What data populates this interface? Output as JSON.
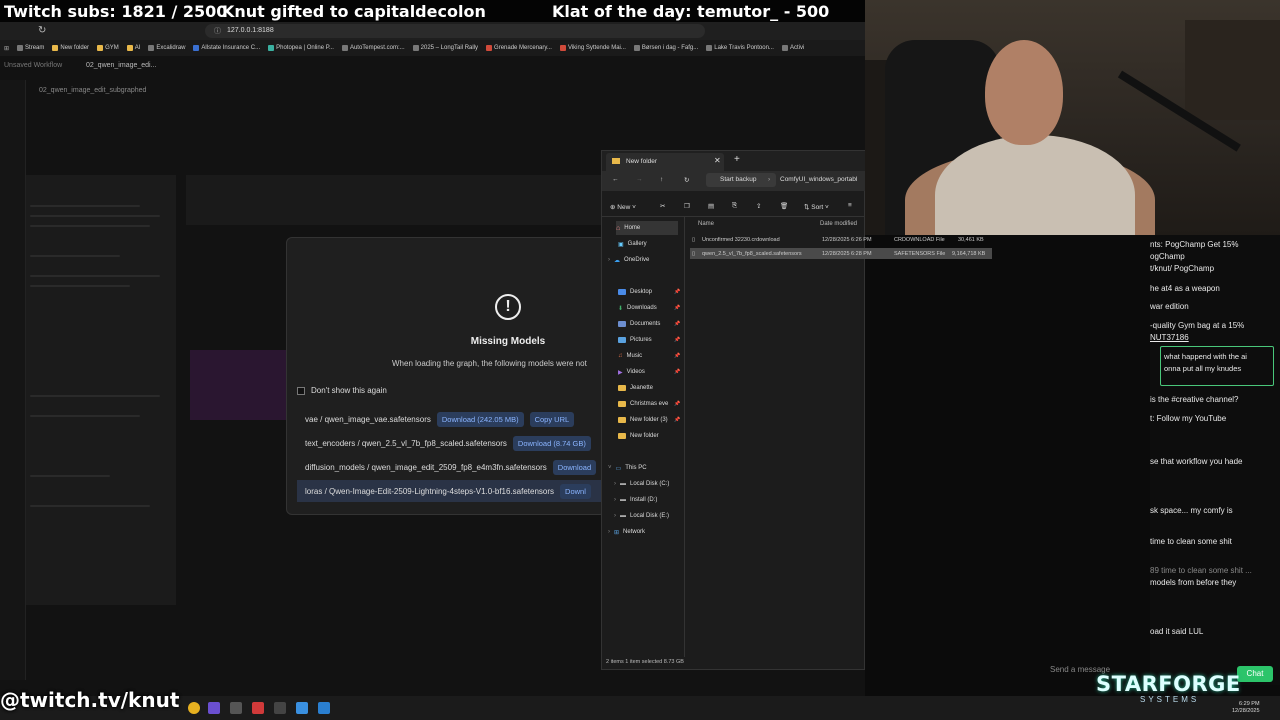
{
  "overlay": {
    "subs_text": "Twitch subs: 1821 / 2500",
    "gift_text": "Knut gifted to capitaldecolon",
    "klat_text": "Klat of the day: temutor_ - 500"
  },
  "browser": {
    "url": "127.0.0.1:8188",
    "bookmarks": [
      "Stream",
      "New folder",
      "GYM",
      "AI",
      "Excalidraw",
      "Allstate Insurance C...",
      "Photopea | Online P...",
      "AutoTempest.com:...",
      "2025 – LongTail Rally",
      "Grenade Mercenary...",
      "Viking Syttende Mai...",
      "Børsen i dag - Fafg...",
      "Lake Travis Pontoon...",
      "Activi"
    ]
  },
  "comfy": {
    "tab_unsaved": "Unsaved Workflow",
    "tab_active": "02_qwen_image_edi...",
    "breadcrumb": "02_qwen_image_edit_subgraphed"
  },
  "modal": {
    "title": "Missing Models",
    "description": "When loading the graph, the following models were not",
    "dont_show": "Don't show this again",
    "models": [
      {
        "name": "vae / qwen_image_vae.safetensors",
        "download": "Download (242.05 MB)",
        "copy": "Copy URL"
      },
      {
        "name": "text_encoders / qwen_2.5_vl_7b_fp8_scaled.safetensors",
        "download": "Download (8.74 GB)",
        "copy": ""
      },
      {
        "name": "diffusion_models / qwen_image_edit_2509_fp8_e4m3fn.safetensors",
        "download": "Download",
        "copy": ""
      },
      {
        "name": "loras / Qwen-Image-Edit-2509-Lightning-4steps-V1.0-bf16.safetensors",
        "download": "Downl",
        "copy": ""
      }
    ]
  },
  "explorer": {
    "tab_title": "New folder",
    "path_1": "Start backup",
    "path_2": "ComfyUI_windows_portabl",
    "new_label": "New",
    "sort_label": "Sort",
    "col_name": "Name",
    "col_date": "Date modified",
    "nav": [
      {
        "label": "Home"
      },
      {
        "label": "Gallery"
      },
      {
        "label": "OneDrive"
      },
      {
        "label": "Desktop"
      },
      {
        "label": "Downloads"
      },
      {
        "label": "Documents"
      },
      {
        "label": "Pictures"
      },
      {
        "label": "Music"
      },
      {
        "label": "Videos"
      },
      {
        "label": "Jeanette"
      },
      {
        "label": "Christmas eve"
      },
      {
        "label": "New folder (3)"
      },
      {
        "label": "New folder"
      },
      {
        "label": "This PC"
      },
      {
        "label": "Local Disk (C:)"
      },
      {
        "label": "Install (D:)"
      },
      {
        "label": "Local Disk (E:)"
      },
      {
        "label": "Network"
      }
    ],
    "files": [
      {
        "name": "Unconfirmed 32230.crdownload",
        "date": "12/28/2025 6:26 PM",
        "type": "CRDOWNLOAD File",
        "size": "30,461 KB"
      },
      {
        "name": "qwen_2.5_vl_7b_fp8_scaled.safetensors",
        "date": "12/28/2025 6:28 PM",
        "type": "SAFETENSORS File",
        "size": "9,164,718 KB"
      }
    ],
    "status": "2 items   1 item selected  8.73 GB"
  },
  "chat": {
    "lines": [
      "nts: PogChamp Get 15%",
      "ogChamp",
      "t/knut/ PogChamp",
      "he at4 as a weapon",
      "war edition",
      "-quality Gym bag at a 15%",
      "NUT37186",
      "what happend with the ai",
      "onna put all my knudes",
      "is the #creative channel?",
      "t: Follow my YouTube",
      "se that workflow you hade",
      "sk space... my comfy is",
      "time to clean some shit",
      "89 time to clean some shit ...",
      "models from before they",
      "oad it said LUL"
    ],
    "send_placeholder": "Send a message",
    "chat_button": "Chat"
  },
  "stream": {
    "twitch_url": "@twitch.tv/knut",
    "logo": "STARFORGE",
    "logo_sub": "SYSTEMS"
  },
  "taskbar": {
    "time": "6:29 PM",
    "date": "12/28/2025"
  }
}
